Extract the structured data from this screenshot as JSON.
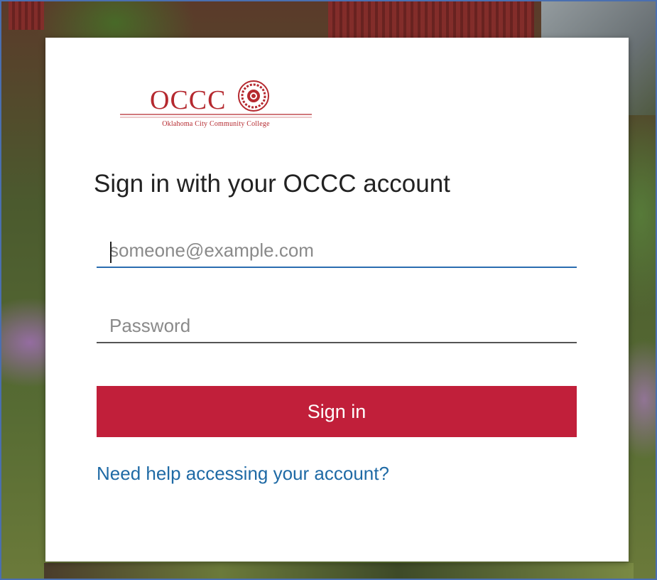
{
  "brand": {
    "logo_text": "OCCC",
    "logo_subtitle": "Oklahoma City Community College",
    "color": "#b5292f"
  },
  "heading": "Sign in with your OCCC account",
  "email": {
    "value": "",
    "placeholder": "someone@example.com"
  },
  "password": {
    "value": "",
    "placeholder": "Password"
  },
  "signin_label": "Sign in",
  "help_link": "Need help accessing your account?",
  "colors": {
    "button": "#c11f3a",
    "link": "#1f6aa5",
    "focus_underline": "#2a6db0"
  }
}
